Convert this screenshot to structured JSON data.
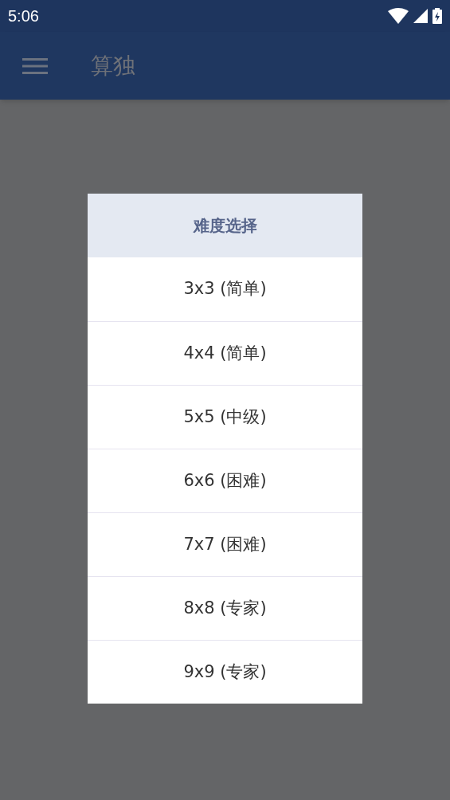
{
  "status_bar": {
    "time": "5:06"
  },
  "app_bar": {
    "title": "算独"
  },
  "dialog": {
    "title": "难度选择",
    "options": [
      {
        "label": "3x3 (简单)"
      },
      {
        "label": "4x4 (简单)"
      },
      {
        "label": "5x5 (中级)"
      },
      {
        "label": "6x6 (困难)"
      },
      {
        "label": "7x7 (困难)"
      },
      {
        "label": "8x8 (专家)"
      },
      {
        "label": "9x9 (专家)"
      }
    ]
  }
}
